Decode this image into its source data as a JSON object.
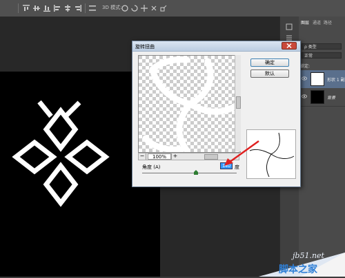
{
  "toolbar": {
    "mode_3d_label": "3D 模式:"
  },
  "layers_panel": {
    "tabs": [
      "图层",
      "通道",
      "路径"
    ],
    "kind_filter": "ρ 类型",
    "blend_mode": "正常",
    "lock_label": "锁定:",
    "layers": [
      {
        "name": "形状 1 副...",
        "thumb": "white-ghost"
      },
      {
        "name": "背景",
        "thumb": "black"
      }
    ]
  },
  "dialog": {
    "title": "旋转扭曲",
    "ok_label": "确定",
    "default_label": "默认",
    "zoom_value": "100%",
    "zoom_minus": "−",
    "zoom_plus": "+",
    "angle_label": "角度 (A)",
    "angle_value": "140",
    "angle_unit": "度",
    "angle_slider_fraction": 0.57
  },
  "watermark": {
    "site": "jb51.net",
    "name": "脚本之家"
  },
  "colors": {
    "accent_input": "#3399ff",
    "annotation_arrow": "#e02020",
    "watermark_blue": "#2f7fd6"
  }
}
